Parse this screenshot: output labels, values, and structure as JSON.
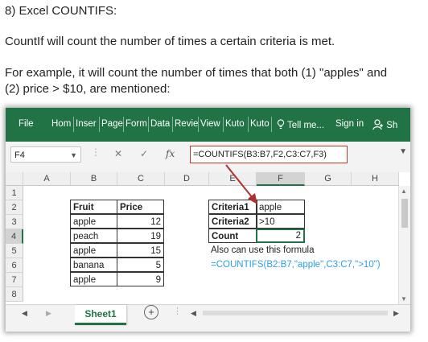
{
  "article": {
    "heading": "8) Excel COUNTIFS:",
    "intro": "CountIf will count the number of times a certain criteria is met.",
    "example_line1": "For example, it will count the number of times that both (1) \"apples\" and",
    "example_line2": "(2) price > $10, are mentioned:"
  },
  "ribbon": {
    "tabs": [
      "File",
      "Hom",
      "Inser",
      "Page",
      "Form",
      "Data",
      "Revie",
      "View",
      "Kuto",
      "Kuto"
    ],
    "tell_me": "Tell me...",
    "sign_in": "Sign in",
    "share": "Sh"
  },
  "formula_bar": {
    "name_box": "F4",
    "fx": "fx",
    "formula": "=COUNTIFS(B3:B7,F2,C3:C7,F3)"
  },
  "grid": {
    "columns": [
      "A",
      "B",
      "C",
      "D",
      "E",
      "F",
      "G",
      "H"
    ],
    "rows": [
      "1",
      "2",
      "3",
      "4",
      "5",
      "6",
      "7",
      "8"
    ],
    "table": {
      "headers": [
        "Fruit",
        "Price"
      ],
      "rows": [
        [
          "apple",
          "12"
        ],
        [
          "peach",
          "19"
        ],
        [
          "apple",
          "15"
        ],
        [
          "banana",
          "5"
        ],
        [
          "apple",
          "9"
        ]
      ]
    },
    "criteria": [
      [
        "Criteria1",
        "apple"
      ],
      [
        "Criteria2",
        ">10"
      ],
      [
        "Count",
        "2"
      ]
    ],
    "note": "Also can use this formula",
    "alt_formula": "=COUNTIFS(B2:B7,\"apple\",C3:C7,\">10\")"
  },
  "sheet_tabs": {
    "active": "Sheet1",
    "add": "+"
  },
  "colors": {
    "ribbon": "#217346",
    "alt_formula": "#2e9fe6",
    "arrow": "#b03030"
  }
}
